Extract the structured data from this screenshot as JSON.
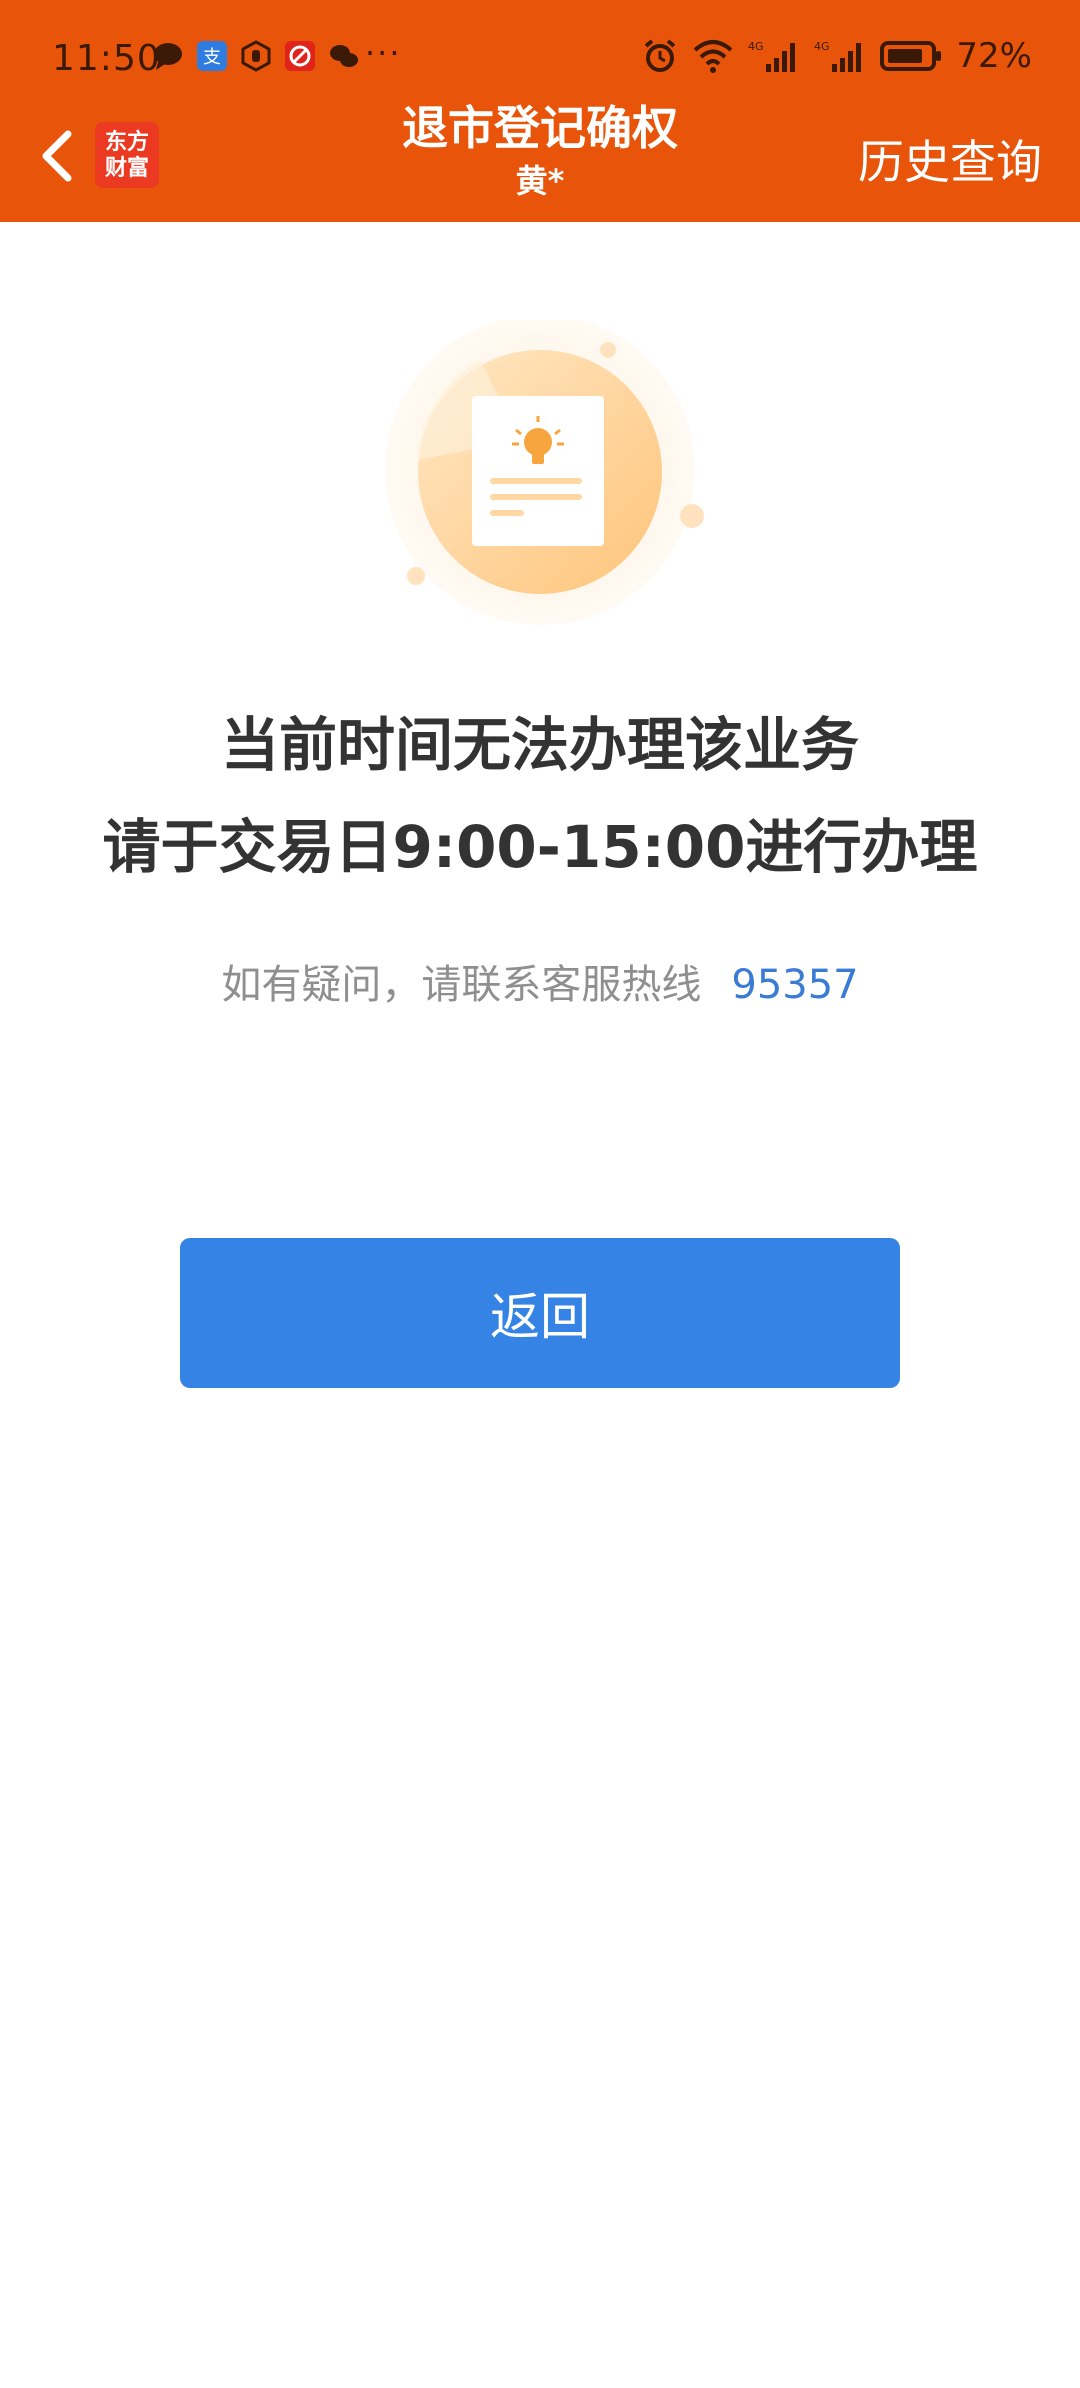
{
  "status_bar": {
    "time": "11:50",
    "battery": "72%",
    "network_1": "4G",
    "network_2": "4G"
  },
  "nav": {
    "title": "退市登记确权",
    "subtitle": "黄*",
    "history_label": "历史查询",
    "logo_line1": "东方",
    "logo_line2": "财富"
  },
  "message": {
    "line1": "当前时间无法办理该业务",
    "line2": "请于交易日9:00-15:00进行办理"
  },
  "contact": {
    "text": "如有疑问，请联系客服热线",
    "phone": "95357"
  },
  "return_button": {
    "label": "返回"
  },
  "colors": {
    "header": "#E8540A",
    "button": "#3583E4",
    "link": "#3A7BD5"
  }
}
